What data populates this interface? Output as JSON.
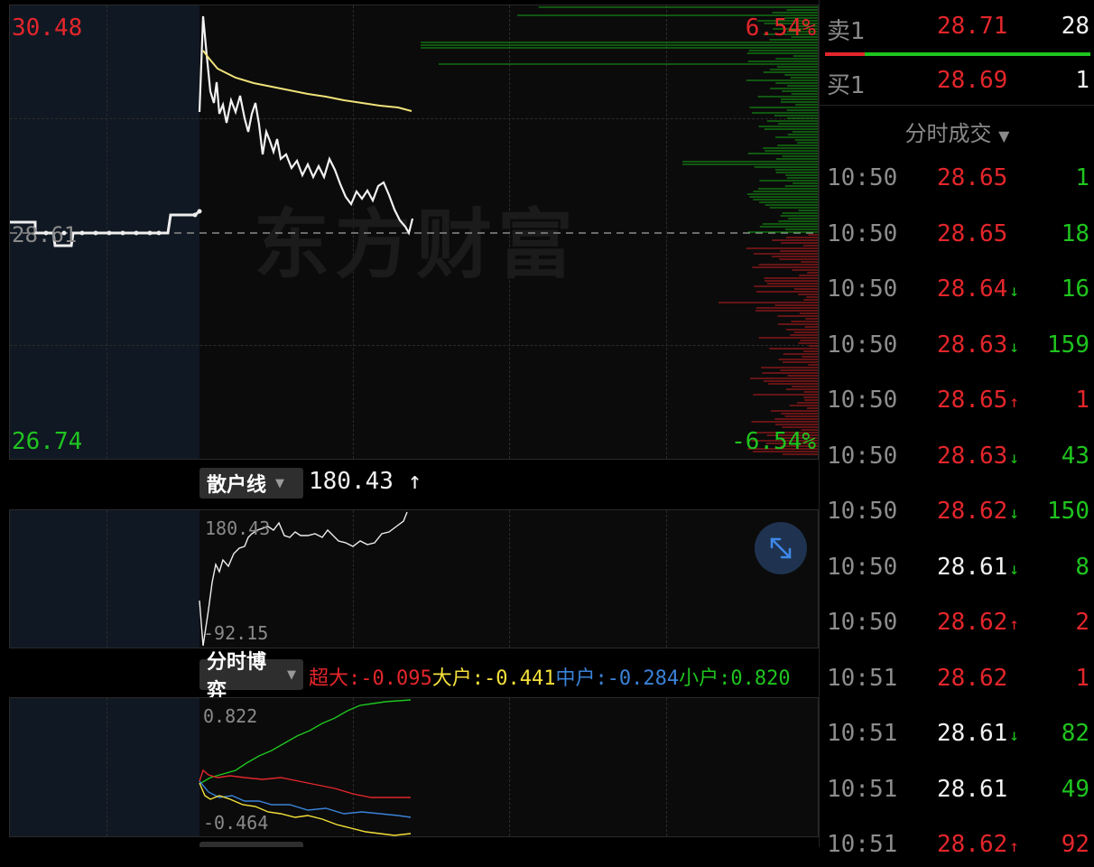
{
  "main_chart": {
    "price_high": "30.48",
    "price_low": "26.74",
    "pct_high": "6.54%",
    "pct_low": "-6.54%",
    "prev_close": "28.61",
    "watermark": "东方财富"
  },
  "retail_line": {
    "selector_label": "散户线",
    "value": "180.43",
    "trend_arrow": "↑",
    "axis_high": "180.43",
    "axis_low": "-92.15"
  },
  "game": {
    "selector_label": "分时博弈",
    "super_large": "超大:-0.095",
    "large": "大户:-0.441",
    "medium": "中户:-0.284",
    "small": "小户:0.820",
    "axis_high": "0.822",
    "axis_low": "-0.464"
  },
  "order_book": {
    "sell_label": "卖1",
    "sell_price": "28.71",
    "sell_volume": "28",
    "buy_label": "买1",
    "buy_price": "28.69",
    "buy_volume": "1"
  },
  "trades": {
    "title": "分时成交",
    "rows": [
      {
        "time": "10:50",
        "price": "28.65",
        "dir": "",
        "vol": "1",
        "pcolor": "red",
        "vcolor": "green"
      },
      {
        "time": "10:50",
        "price": "28.65",
        "dir": "",
        "vol": "18",
        "pcolor": "red",
        "vcolor": "green"
      },
      {
        "time": "10:50",
        "price": "28.64",
        "dir": "↓",
        "vol": "16",
        "pcolor": "red",
        "vcolor": "green"
      },
      {
        "time": "10:50",
        "price": "28.63",
        "dir": "↓",
        "vol": "159",
        "pcolor": "red",
        "vcolor": "green"
      },
      {
        "time": "10:50",
        "price": "28.65",
        "dir": "↑",
        "vol": "1",
        "pcolor": "red",
        "vcolor": "red"
      },
      {
        "time": "10:50",
        "price": "28.63",
        "dir": "↓",
        "vol": "43",
        "pcolor": "red",
        "vcolor": "green"
      },
      {
        "time": "10:50",
        "price": "28.62",
        "dir": "↓",
        "vol": "150",
        "pcolor": "red",
        "vcolor": "green"
      },
      {
        "time": "10:50",
        "price": "28.61",
        "dir": "↓",
        "vol": "8",
        "pcolor": "white",
        "vcolor": "green"
      },
      {
        "time": "10:50",
        "price": "28.62",
        "dir": "↑",
        "vol": "2",
        "pcolor": "red",
        "vcolor": "red"
      },
      {
        "time": "10:51",
        "price": "28.62",
        "dir": "",
        "vol": "1",
        "pcolor": "red",
        "vcolor": "red"
      },
      {
        "time": "10:51",
        "price": "28.61",
        "dir": "↓",
        "vol": "82",
        "pcolor": "white",
        "vcolor": "green"
      },
      {
        "time": "10:51",
        "price": "28.61",
        "dir": "",
        "vol": "49",
        "pcolor": "white",
        "vcolor": "green"
      },
      {
        "time": "10:51",
        "price": "28.62",
        "dir": "↑",
        "vol": "92",
        "pcolor": "red",
        "vcolor": "red"
      }
    ]
  },
  "colors": {
    "up": "#e3262b",
    "down": "#1fc41f",
    "avg_line": "#f0e27a",
    "medium": "#3a82d8"
  },
  "icons": {
    "expand": "expand-arrows-icon",
    "dropdown": "triangle-down-icon"
  }
}
